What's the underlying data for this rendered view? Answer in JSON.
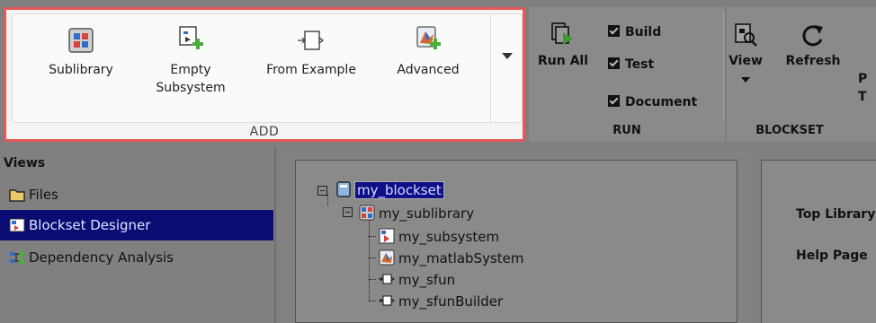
{
  "toolstrip": {
    "add_section": {
      "caption": "ADD",
      "buttons": [
        {
          "label": "Sublibrary",
          "icon": "sublibrary-icon"
        },
        {
          "label": "Empty Subsystem",
          "label_line1": "Empty",
          "label_line2": "Subsystem",
          "icon": "empty-subsystem-icon"
        },
        {
          "label": "From Example",
          "icon": "from-example-icon"
        },
        {
          "label": "Advanced",
          "icon": "advanced-icon"
        }
      ],
      "more_icon": "chevron-down-icon"
    },
    "run_section": {
      "caption": "RUN",
      "run_all_label": "Run All",
      "options": [
        {
          "label": "Build",
          "checked": true
        },
        {
          "label": "Test",
          "checked": true
        },
        {
          "label": "Document",
          "checked": true
        }
      ]
    },
    "blockset_section": {
      "caption": "BLOCKSET",
      "view_label": "View",
      "refresh_label": "Refresh",
      "cut_label_line1": "P",
      "cut_label_line2": "T"
    },
    "highlight_color": "#e8585a"
  },
  "views": {
    "title": "Views",
    "items": [
      {
        "label": "Files",
        "icon": "folder-icon",
        "selected": false
      },
      {
        "label": "Blockset Designer",
        "icon": "blockset-designer-icon",
        "selected": true
      },
      {
        "label": "Dependency Analysis",
        "icon": "dependency-icon",
        "selected": false
      }
    ],
    "selection_color": "#0b0b74"
  },
  "tree": {
    "root": {
      "label": "my_blockset",
      "selected": true,
      "icon": "blockset-icon"
    },
    "sublibrary": {
      "label": "my_sublibrary",
      "icon": "sublibrary-icon"
    },
    "children": [
      {
        "label": "my_subsystem",
        "icon": "subsystem-icon"
      },
      {
        "label": "my_matlabSystem",
        "icon": "matlab-system-icon"
      },
      {
        "label": "my_sfun",
        "icon": "sfunction-icon"
      },
      {
        "label": "my_sfunBuilder",
        "icon": "sfunction-icon"
      }
    ]
  },
  "properties": {
    "labels": [
      "Top Library",
      "Help Page"
    ]
  }
}
